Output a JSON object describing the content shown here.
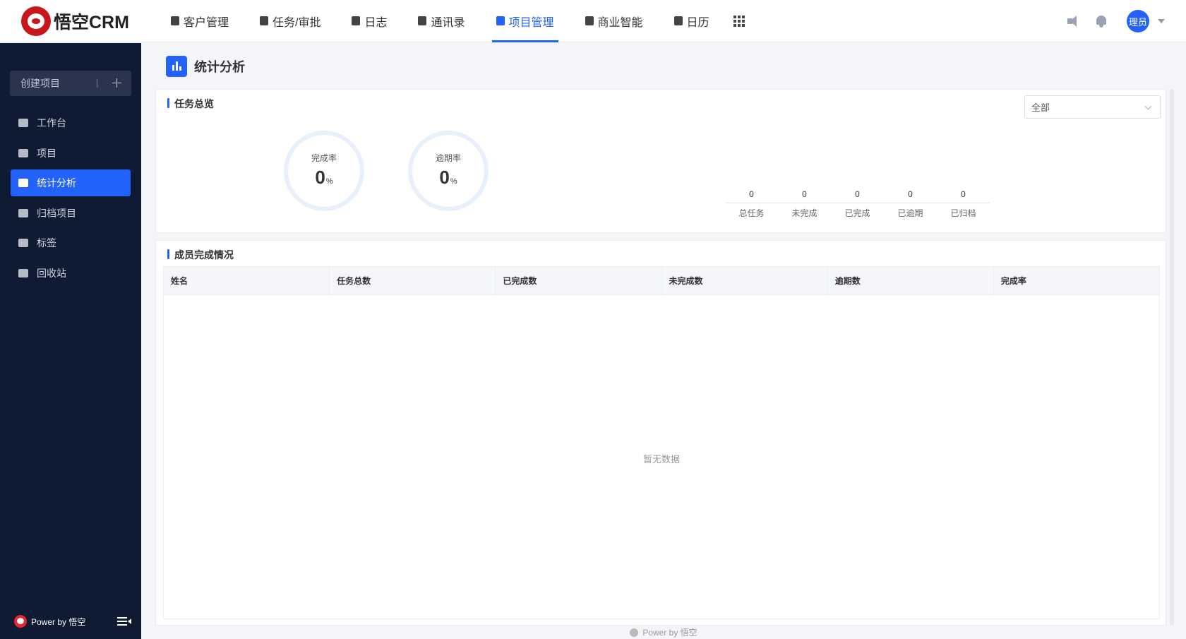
{
  "brand": {
    "name": "悟空CRM"
  },
  "nav": {
    "items": [
      {
        "label": "客户管理",
        "active": false
      },
      {
        "label": "任务/审批",
        "active": false
      },
      {
        "label": "日志",
        "active": false
      },
      {
        "label": "通讯录",
        "active": false
      },
      {
        "label": "项目管理",
        "active": true
      },
      {
        "label": "商业智能",
        "active": false
      },
      {
        "label": "日历",
        "active": false
      }
    ]
  },
  "user": {
    "avatar_text": "理员"
  },
  "sidebar": {
    "create_label": "创建项目",
    "items": [
      {
        "label": "工作台",
        "icon": "monitor-icon"
      },
      {
        "label": "项目",
        "icon": "list-icon"
      },
      {
        "label": "统计分析",
        "icon": "bar-chart-icon",
        "active": true
      },
      {
        "label": "归档项目",
        "icon": "archive-icon"
      },
      {
        "label": "标签",
        "icon": "tag-icon"
      },
      {
        "label": "回收站",
        "icon": "trash-icon"
      }
    ],
    "footer": "Power by 悟空"
  },
  "page": {
    "title": "统计分析",
    "overview": {
      "title": "任务总览",
      "filter_value": "全部",
      "completion_rate": {
        "label": "完成率",
        "value": "0",
        "unit": "%"
      },
      "overdue_rate": {
        "label": "逾期率",
        "value": "0",
        "unit": "%"
      },
      "stats": [
        {
          "label": "总任务",
          "value": "0"
        },
        {
          "label": "未完成",
          "value": "0"
        },
        {
          "label": "已完成",
          "value": "0"
        },
        {
          "label": "已逾期",
          "value": "0"
        },
        {
          "label": "已归档",
          "value": "0"
        }
      ]
    },
    "members": {
      "title": "成员完成情况",
      "columns": [
        "姓名",
        "任务总数",
        "已完成数",
        "未完成数",
        "逾期数",
        "完成率"
      ],
      "empty_text": "暂无数据"
    },
    "footer": "Power by 悟空"
  },
  "colors": {
    "accent": "#2362fb",
    "sidebar_bg": "#0f1a33"
  }
}
